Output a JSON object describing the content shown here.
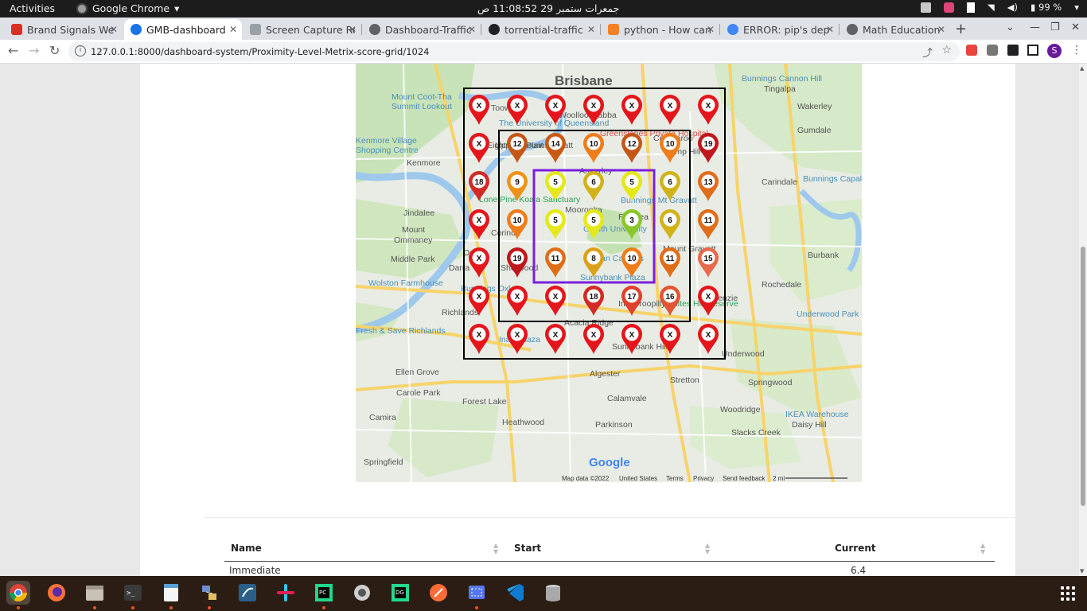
{
  "system": {
    "activities": "Activities",
    "app_name": "Google Chrome",
    "clock": "جمعرات ستمبر 29  11:08:52 ص",
    "battery": "99 %"
  },
  "tabs": [
    {
      "title": "Brand Signals We",
      "color": "#d93025",
      "active": false
    },
    {
      "title": "GMB-dashboard",
      "color": "#1a73e8",
      "active": true
    },
    {
      "title": "Screen Capture Re",
      "color": "#9aa0a6",
      "active": false
    },
    {
      "title": "Dashboard-Traffic",
      "color": "#5f6368",
      "active": false
    },
    {
      "title": "torrential-traffic",
      "color": "#202124",
      "active": false
    },
    {
      "title": "python - How can",
      "color": "#f48024",
      "active": false
    },
    {
      "title": "ERROR: pip's dep",
      "color": "#4285f4",
      "active": false
    },
    {
      "title": "Math Education P",
      "color": "#5f6368",
      "active": false
    }
  ],
  "toolbar": {
    "url": "127.0.0.1:8000/dashboard-system/Proximity-Level-Metrix-score-grid/1024",
    "profile_initial": "S"
  },
  "map": {
    "labels": [
      {
        "text": "Brisbane",
        "size": "big"
      },
      {
        "text": "Mount Coot-Tha",
        "size": "small",
        "color": "#4a8fb8"
      },
      {
        "text": "Summit Lookout",
        "size": "small",
        "color": "#4a8fb8"
      },
      {
        "text": "Toowong",
        "size": "small"
      },
      {
        "text": "Woolloongabba",
        "size": "small"
      },
      {
        "text": "Kenmore Village",
        "size": "small",
        "color": "#4a8fb8"
      },
      {
        "text": "Shopping Centre",
        "size": "small",
        "color": "#4a8fb8"
      },
      {
        "text": "Kenmore",
        "size": "small"
      },
      {
        "text": "Jindalee",
        "size": "small"
      },
      {
        "text": "Mount",
        "size": "small"
      },
      {
        "text": "Ommaney",
        "size": "small"
      },
      {
        "text": "Middle Park",
        "size": "small"
      },
      {
        "text": "Wolston Farmhouse",
        "size": "small",
        "color": "#4a8fb8"
      },
      {
        "text": "Richlands",
        "size": "small"
      },
      {
        "text": "Inala Plaza",
        "size": "small",
        "color": "#4a8fb8"
      },
      {
        "text": "Ellen Grove",
        "size": "small"
      },
      {
        "text": "Carole Park",
        "size": "small"
      },
      {
        "text": "Camira",
        "size": "small"
      },
      {
        "text": "Springfield",
        "size": "small"
      },
      {
        "text": "Forest Lake",
        "size": "small"
      },
      {
        "text": "Heathwood",
        "size": "small"
      },
      {
        "text": "Algester",
        "size": "small"
      },
      {
        "text": "Calamvale",
        "size": "small"
      },
      {
        "text": "Parkinson",
        "size": "small"
      },
      {
        "text": "Stretton",
        "size": "small"
      },
      {
        "text": "Springwood",
        "size": "small"
      },
      {
        "text": "Woodridge",
        "size": "small"
      },
      {
        "text": "Slacks Creek",
        "size": "small"
      },
      {
        "text": "IKEA Warehouse",
        "size": "small",
        "color": "#4a8fb8"
      },
      {
        "text": "Daisy Hill",
        "size": "small"
      },
      {
        "text": "Underwood",
        "size": "small"
      },
      {
        "text": "Underwood Park Priestdale",
        "size": "small",
        "color": "#4a8fb8"
      },
      {
        "text": "Burbank",
        "size": "small"
      },
      {
        "text": "Rochedale",
        "size": "small"
      },
      {
        "text": "Carindale",
        "size": "small"
      },
      {
        "text": "Gumdale",
        "size": "small"
      },
      {
        "text": "Wakerley",
        "size": "small"
      },
      {
        "text": "Tingalpa",
        "size": "small"
      },
      {
        "text": "Bunnings Cannon Hill",
        "size": "small",
        "color": "#4a8fb8"
      },
      {
        "text": "Bunnings Capalaba",
        "size": "small",
        "color": "#4a8fb8"
      },
      {
        "text": "Moorooka",
        "size": "small"
      },
      {
        "text": "Griffith University",
        "size": "small",
        "color": "#4a8fb8"
      },
      {
        "text": "Nathan Campus",
        "size": "small",
        "color": "#4a8fb8"
      },
      {
        "text": "Sunnybank Plaza",
        "size": "small",
        "color": "#4a8fb8"
      },
      {
        "text": "Acacia Ridge",
        "size": "small"
      },
      {
        "text": "Sunnybank Hills",
        "size": "small"
      },
      {
        "text": "Lone Pine Koala Sanctuary",
        "size": "small",
        "color": "#2e9e57"
      },
      {
        "text": "Annerley",
        "size": "small"
      },
      {
        "text": "Greenslopes Private Hospital",
        "size": "small",
        "color": "#d9534f"
      },
      {
        "text": "Bunnings Mt Gravatt",
        "size": "small",
        "color": "#4a8fb8"
      },
      {
        "text": "The University of Queensland",
        "size": "small",
        "color": "#4a8fb8"
      },
      {
        "text": "Fresh & Save Richlands",
        "size": "small",
        "color": "#4a8fb8"
      },
      {
        "text": "Bunnings Oxley",
        "size": "small",
        "color": "#4a8fb8"
      },
      {
        "text": "Oxley",
        "size": "small"
      },
      {
        "text": "Darra",
        "size": "small"
      },
      {
        "text": "Corinda",
        "size": "small"
      },
      {
        "text": "Sherwood",
        "size": "small"
      },
      {
        "text": "Rocklea",
        "size": "small"
      },
      {
        "text": "Mount Gravatt",
        "size": "small"
      },
      {
        "text": "Upper Mount Gravatt",
        "size": "small"
      },
      {
        "text": "Coorparoo",
        "size": "small"
      },
      {
        "text": "Camp Hill",
        "size": "small"
      },
      {
        "text": "Whites Hill Reserve",
        "size": "small",
        "color": "#2e9e57"
      },
      {
        "text": "Mackenzie",
        "size": "small"
      },
      {
        "text": "Eight Mile Plains",
        "size": "small"
      },
      {
        "text": "Indooroopilly",
        "size": "small"
      },
      {
        "text": "Fairfield",
        "size": "small"
      }
    ],
    "google_logo": "Google",
    "attribution": {
      "map_data": "Map data ©2022",
      "country": "United States",
      "terms": "Terms",
      "privacy": "Privacy",
      "feedback": "Send feedback",
      "scale": "2 mi"
    },
    "grid_rows": [
      [
        "X",
        "X",
        "X",
        "X",
        "X",
        "X",
        "X"
      ],
      [
        "X",
        "12",
        "14",
        "10",
        "12",
        "10",
        "19"
      ],
      [
        "18",
        "9",
        "5",
        "6",
        "5",
        "6",
        "13"
      ],
      [
        "X",
        "10",
        "5",
        "5",
        "3",
        "6",
        "11"
      ],
      [
        "X",
        "19",
        "11",
        "8",
        "10",
        "11",
        "15"
      ],
      [
        "X",
        "X",
        "X",
        "18",
        "17",
        "16",
        "X"
      ],
      [
        "X",
        "X",
        "X",
        "X",
        "X",
        "X",
        "X"
      ]
    ],
    "pin_colors": {
      "X": "#e4161b",
      "19": "#c0171c",
      "18": "#d22a25",
      "17": "#e0402e",
      "16": "#e25533",
      "15": "#e76a4c",
      "14": "#c95a14",
      "13": "#e06d1e",
      "12": "#c55716",
      "11": "#e06d17",
      "10": "#ee7d1a",
      "9": "#ef9218",
      "8": "#dca11a",
      "6": "#d1b318",
      "5": "#e5e81a",
      "3": "#8bc72a"
    },
    "box_colors": {
      "outer": "#000000",
      "middle": "#000000",
      "inner": "#7a1fe0"
    }
  },
  "table": {
    "columns": [
      "Name",
      "Start",
      "Current"
    ],
    "rows": [
      [
        "Immediate",
        "",
        "6.4"
      ]
    ]
  }
}
